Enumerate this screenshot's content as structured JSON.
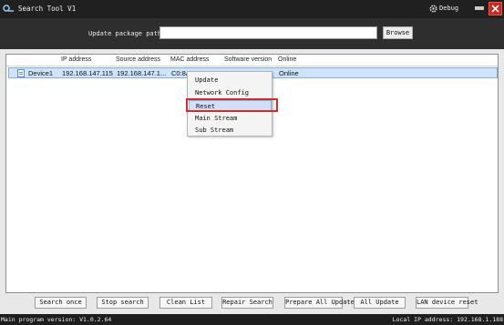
{
  "window": {
    "title": "Search Tool V1",
    "debug_label": "Debug",
    "icons": [
      "app-logo-icon",
      "gear-icon",
      "minimize-icon",
      "close-icon"
    ]
  },
  "path_bar": {
    "label": "Update package path:",
    "input_value": "",
    "browse_label": "Browse"
  },
  "device_list": {
    "columns": [
      "IP address",
      "Source address",
      "MAC address",
      "Software version",
      "Online"
    ],
    "rows": [
      {
        "name": "Device1",
        "ip": "192.168.147.115",
        "source": "192.168.147.1...",
        "mac": "C0:8A",
        "version": "",
        "online": "Online"
      }
    ]
  },
  "context_menu": {
    "items": [
      "Update",
      "Network Config",
      "Reset",
      "Main Stream",
      "Sub Stream"
    ],
    "selected": "Reset"
  },
  "buttons": {
    "search_once": "Search once",
    "stop_search": "Stop search",
    "clean_list": "Clean List",
    "repair_search": "Repair Search",
    "prepare_all_update": "Prepare All Update",
    "all_update": "All Update",
    "lan_device_reset": "LAN device reset"
  },
  "status": {
    "left": "Main program version: V1.0.2.64",
    "right": "Local IP address: 192.168.1.188"
  },
  "colors": {
    "highlight_border": "#d42a2a",
    "row_selected": "#cfe3fb",
    "close_button": "#c8281f"
  }
}
